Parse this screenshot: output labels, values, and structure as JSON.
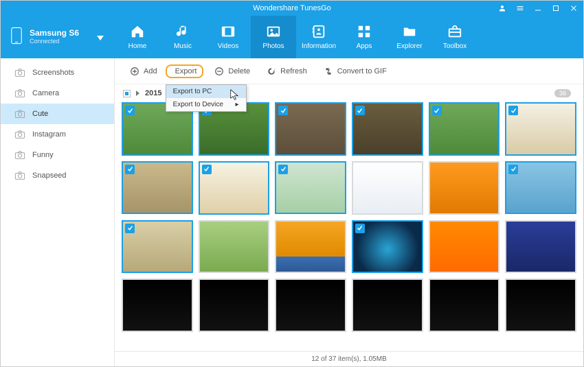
{
  "title": "Wondershare TunesGo",
  "device": {
    "name": "Samsung S6",
    "status": "Connected"
  },
  "nav": [
    {
      "label": "Home"
    },
    {
      "label": "Music"
    },
    {
      "label": "Videos"
    },
    {
      "label": "Photos",
      "active": true
    },
    {
      "label": "Information"
    },
    {
      "label": "Apps"
    },
    {
      "label": "Explorer"
    },
    {
      "label": "Toolbox"
    }
  ],
  "sidebar": [
    {
      "label": "Screenshots"
    },
    {
      "label": "Camera"
    },
    {
      "label": "Cute",
      "active": true
    },
    {
      "label": "Instagram"
    },
    {
      "label": "Funny"
    },
    {
      "label": "Snapseed"
    }
  ],
  "actions": {
    "add": "Add",
    "export": "Export",
    "delete": "Delete",
    "refresh": "Refresh",
    "convert": "Convert to GIF"
  },
  "export_menu": {
    "item1": "Export to PC",
    "item2": "Export to Device"
  },
  "group": {
    "year": "2015",
    "count": "36"
  },
  "thumbs": [
    {
      "sel": true,
      "bg": "linear-gradient(180deg,#6fa85a 0%,#4e8a3a 100%)"
    },
    {
      "sel": true,
      "bg": "linear-gradient(180deg,#58913c 0%,#3a6c2a 100%)"
    },
    {
      "sel": true,
      "bg": "linear-gradient(180deg,#7a6a52 0%,#5d4e3a 100%)"
    },
    {
      "sel": true,
      "bg": "linear-gradient(180deg,#6a5d3f 0%,#4a3f2a 100%)"
    },
    {
      "sel": true,
      "bg": "linear-gradient(180deg,#6fa85a 0%,#4e8a3a 100%)"
    },
    {
      "sel": true,
      "bg": "linear-gradient(180deg,#f4f0e4 0%,#d9cba6 100%)"
    },
    {
      "sel": true,
      "bg": "linear-gradient(180deg,#c9b98a 0%,#a7946a 100%)"
    },
    {
      "sel": true,
      "bg": "linear-gradient(180deg,#f6f2e2 0%,#e0d0a8 100%)"
    },
    {
      "sel": true,
      "bg": "linear-gradient(180deg,#cfe5d0 0%,#a6cfa6 100%)"
    },
    {
      "sel": false,
      "bg": "linear-gradient(180deg,#ffffff 0%,#e8eef4 100%)"
    },
    {
      "sel": false,
      "bg": "linear-gradient(180deg,#ff9a1f 0%,#e07a00 100%)"
    },
    {
      "sel": true,
      "bg": "linear-gradient(180deg,#8ac4e4 0%,#5aa3cd 100%)"
    },
    {
      "sel": true,
      "bg": "linear-gradient(180deg,#d9cfa6 0%,#b6a87a 100%)"
    },
    {
      "sel": false,
      "bg": "linear-gradient(180deg,#a8cf80 0%,#7aaa50 100%)"
    },
    {
      "sel": false,
      "bg": "linear-gradient(180deg,#f5a623 0%,#e08a00 70%,#3a6eb3 70%,#2e5a95 100%)"
    },
    {
      "sel": true,
      "bg": "radial-gradient(circle at 50% 55%,#2aa4d6 0%,#0a2a4a 70%)"
    },
    {
      "sel": false,
      "bg": "linear-gradient(180deg,#ff8a00 0%,#ff6a00 100%)"
    },
    {
      "sel": false,
      "bg": "linear-gradient(180deg,#2a3d9a 0%,#1a2868 100%)"
    },
    {
      "sel": false,
      "bg": "linear-gradient(180deg,#000 0%,#111 100%)"
    },
    {
      "sel": false,
      "bg": "linear-gradient(180deg,#000 0%,#111 100%)"
    },
    {
      "sel": false,
      "bg": "linear-gradient(180deg,#000 0%,#111 100%)"
    },
    {
      "sel": false,
      "bg": "linear-gradient(180deg,#000 0%,#111 100%)"
    },
    {
      "sel": false,
      "bg": "linear-gradient(180deg,#000 0%,#111 100%)"
    },
    {
      "sel": false,
      "bg": "linear-gradient(180deg,#000 0%,#111 100%)"
    }
  ],
  "status": "12 of 37 item(s), 1.05MB"
}
